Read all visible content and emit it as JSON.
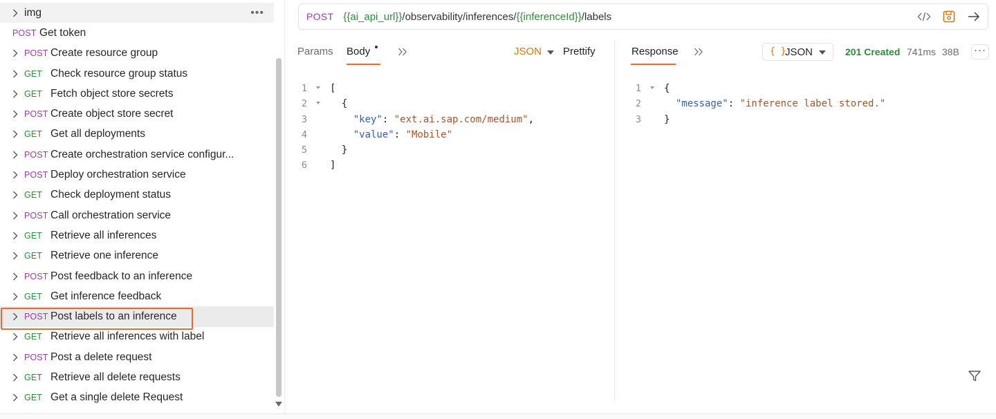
{
  "sidebar": {
    "folder": {
      "label": "img"
    },
    "token_item": {
      "method": "POST",
      "label": "Get token"
    },
    "items": [
      {
        "method": "POST",
        "label": "Create resource group"
      },
      {
        "method": "GET",
        "label": "Check resource group status"
      },
      {
        "method": "GET",
        "label": "Fetch object store secrets"
      },
      {
        "method": "POST",
        "label": "Create object store secret"
      },
      {
        "method": "GET",
        "label": "Get all deployments"
      },
      {
        "method": "POST",
        "label": "Create orchestration service configur..."
      },
      {
        "method": "POST",
        "label": "Deploy orchestration service"
      },
      {
        "method": "GET",
        "label": "Check deployment status"
      },
      {
        "method": "POST",
        "label": "Call orchestration service"
      },
      {
        "method": "GET",
        "label": "Retrieve all inferences"
      },
      {
        "method": "GET",
        "label": "Retrieve one inference"
      },
      {
        "method": "POST",
        "label": "Post feedback to an inference"
      },
      {
        "method": "GET",
        "label": "Get inference feedback"
      },
      {
        "method": "POST",
        "label": "Post labels to an inference"
      },
      {
        "method": "GET",
        "label": "Retrieve all inferences with label"
      },
      {
        "method": "POST",
        "label": "Post a delete request"
      },
      {
        "method": "GET",
        "label": "Retrieve all delete requests"
      },
      {
        "method": "GET",
        "label": "Get a single delete Request"
      }
    ],
    "selected_index": 13
  },
  "request": {
    "method": "POST",
    "url_parts": [
      {
        "text": "{{ai_api_url}}",
        "var": true
      },
      {
        "text": "/observability/inferences/",
        "var": false
      },
      {
        "text": "{{inferenceId}}",
        "var": true
      },
      {
        "text": "/labels",
        "var": false
      }
    ],
    "tabs": {
      "params": "Params",
      "body": "Body"
    },
    "body_format": "JSON",
    "prettify": "Prettify",
    "body_lines": [
      "1",
      "2",
      "3",
      "4",
      "5",
      "6"
    ],
    "body": {
      "key_name": "\"key\"",
      "key_value": "\"ext.ai.sap.com/medium\"",
      "value_name": "\"value\"",
      "value_value": "\"Mobile\""
    }
  },
  "response": {
    "tab": "Response",
    "format": "JSON",
    "format_icon": "{ }",
    "status": "201 Created",
    "time": "741ms",
    "size": "38B",
    "lines": [
      "1",
      "2",
      "3"
    ],
    "body": {
      "message_key": "\"message\"",
      "message_value": "\"inference label stored.\""
    }
  },
  "colors": {
    "accent": "#ee6a2c",
    "post": "#9c3aab",
    "get": "#2f8a3e",
    "variable": "#2f8a3e",
    "json_key": "#2f5fad",
    "json_string": "#a5542a"
  }
}
